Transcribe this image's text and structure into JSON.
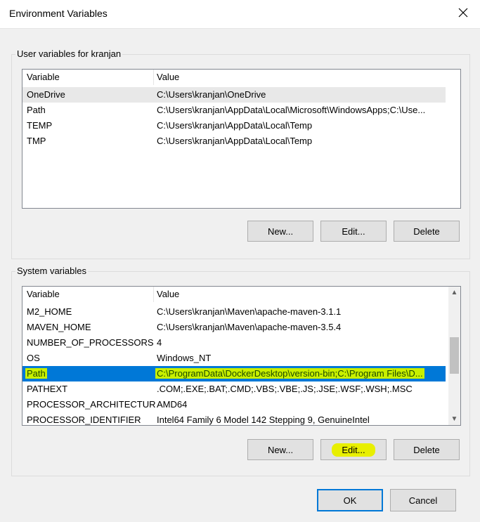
{
  "window": {
    "title": "Environment Variables"
  },
  "colors": {
    "selection": "#0078d7",
    "highlight": "#c8f000"
  },
  "user_vars": {
    "group_label": "User variables for kranjan",
    "headers": {
      "variable": "Variable",
      "value": "Value"
    },
    "rows": [
      {
        "name": "OneDrive",
        "value": "C:\\Users\\kranjan\\OneDrive"
      },
      {
        "name": "Path",
        "value": "C:\\Users\\kranjan\\AppData\\Local\\Microsoft\\WindowsApps;C:\\Use..."
      },
      {
        "name": "TEMP",
        "value": "C:\\Users\\kranjan\\AppData\\Local\\Temp"
      },
      {
        "name": "TMP",
        "value": "C:\\Users\\kranjan\\AppData\\Local\\Temp"
      }
    ],
    "buttons": {
      "new": "New...",
      "edit": "Edit...",
      "delete": "Delete"
    }
  },
  "system_vars": {
    "group_label": "System variables",
    "headers": {
      "variable": "Variable",
      "value": "Value"
    },
    "rows": [
      {
        "name": "M2_HOME",
        "value": "C:\\Users\\kranjan\\Maven\\apache-maven-3.1.1"
      },
      {
        "name": "MAVEN_HOME",
        "value": "C:\\Users\\kranjan\\Maven\\apache-maven-3.5.4"
      },
      {
        "name": "NUMBER_OF_PROCESSORS",
        "value": "4"
      },
      {
        "name": "OS",
        "value": "Windows_NT"
      },
      {
        "name": "Path",
        "value": "C:\\ProgramData\\DockerDesktop\\version-bin;C:\\Program Files\\D..."
      },
      {
        "name": "PATHEXT",
        "value": ".COM;.EXE;.BAT;.CMD;.VBS;.VBE;.JS;.JSE;.WSF;.WSH;.MSC"
      },
      {
        "name": "PROCESSOR_ARCHITECTURE",
        "value": "AMD64"
      },
      {
        "name": "PROCESSOR_IDENTIFIER",
        "value": "Intel64 Family 6 Model 142 Stepping 9, GenuineIntel"
      }
    ],
    "buttons": {
      "new": "New...",
      "edit": "Edit...",
      "delete": "Delete"
    }
  },
  "footer": {
    "ok": "OK",
    "cancel": "Cancel"
  }
}
